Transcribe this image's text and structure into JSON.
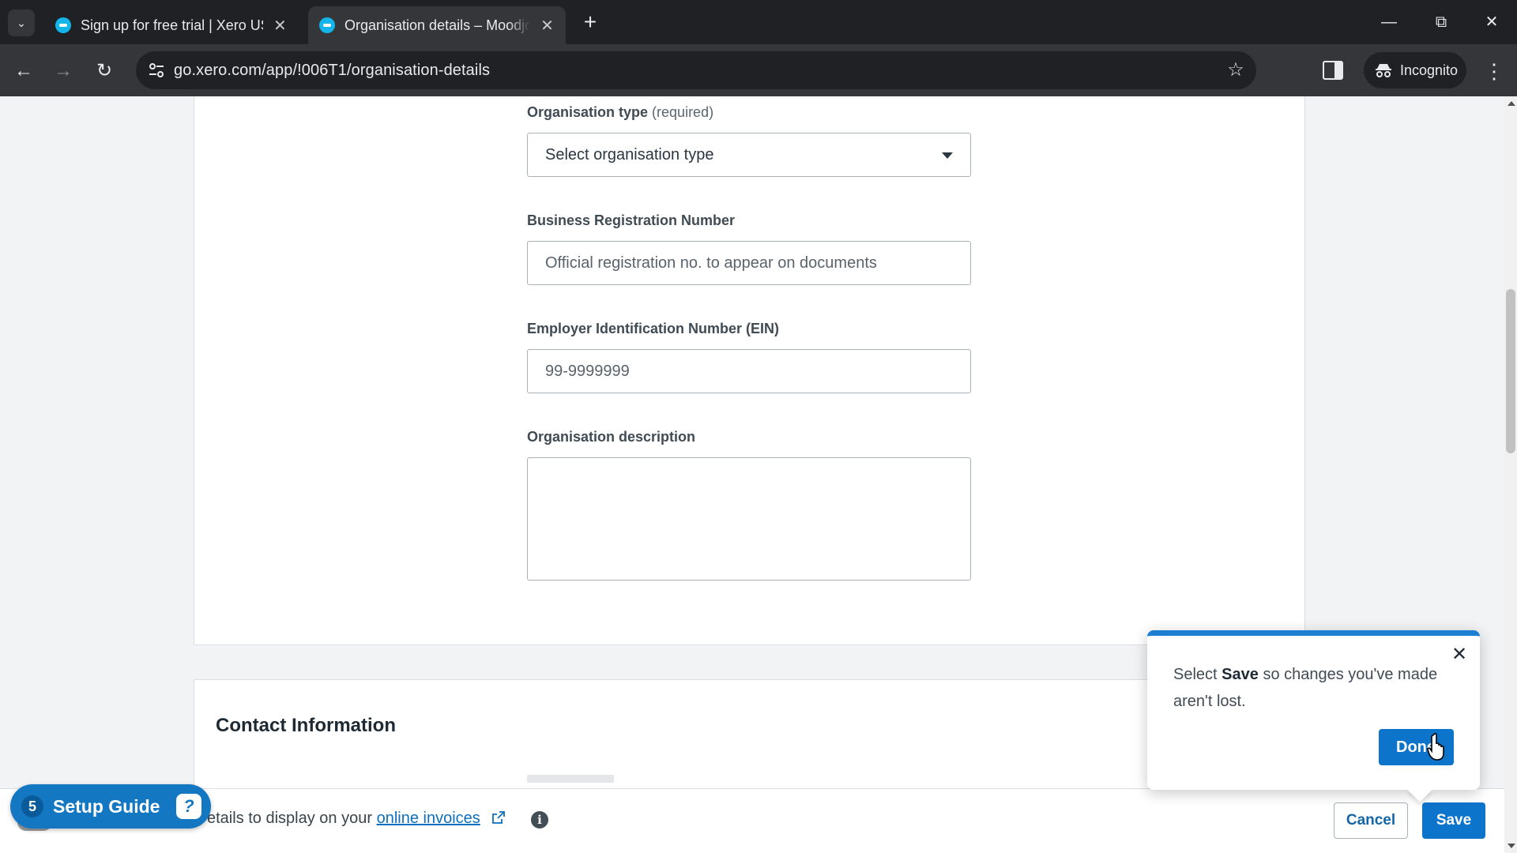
{
  "browser": {
    "tabs": [
      {
        "title": "Sign up for free trial | Xero US",
        "active": false
      },
      {
        "title": "Organisation details – Moodjoy",
        "active": true
      }
    ],
    "url": "go.xero.com/app/!006T1/organisation-details",
    "profile_label": "Incognito"
  },
  "form": {
    "org_type": {
      "label": "Organisation type",
      "required": "(required)",
      "value": "Select organisation type"
    },
    "business_reg": {
      "label": "Business Registration Number",
      "placeholder": "Official registration no. to appear on documents"
    },
    "ein": {
      "label": "Employer Identification Number (EIN)",
      "placeholder": "99-9999999"
    },
    "description": {
      "label": "Organisation description",
      "value": ""
    }
  },
  "contact": {
    "title": "Contact Information"
  },
  "footer": {
    "hint_prefix": "etails to display on your",
    "hint_link": "online invoices",
    "cancel_label": "Cancel",
    "save_label": "Save"
  },
  "setup_guide": {
    "count": "5",
    "label": "Setup Guide"
  },
  "popover": {
    "text_before": "Select",
    "text_bold": "Save",
    "text_after": "so changes you've made aren't lost.",
    "done_label": "Done"
  },
  "colors": {
    "accent": "#0c74cb",
    "link": "#0d6fbf",
    "brand": "#13b5ea"
  }
}
